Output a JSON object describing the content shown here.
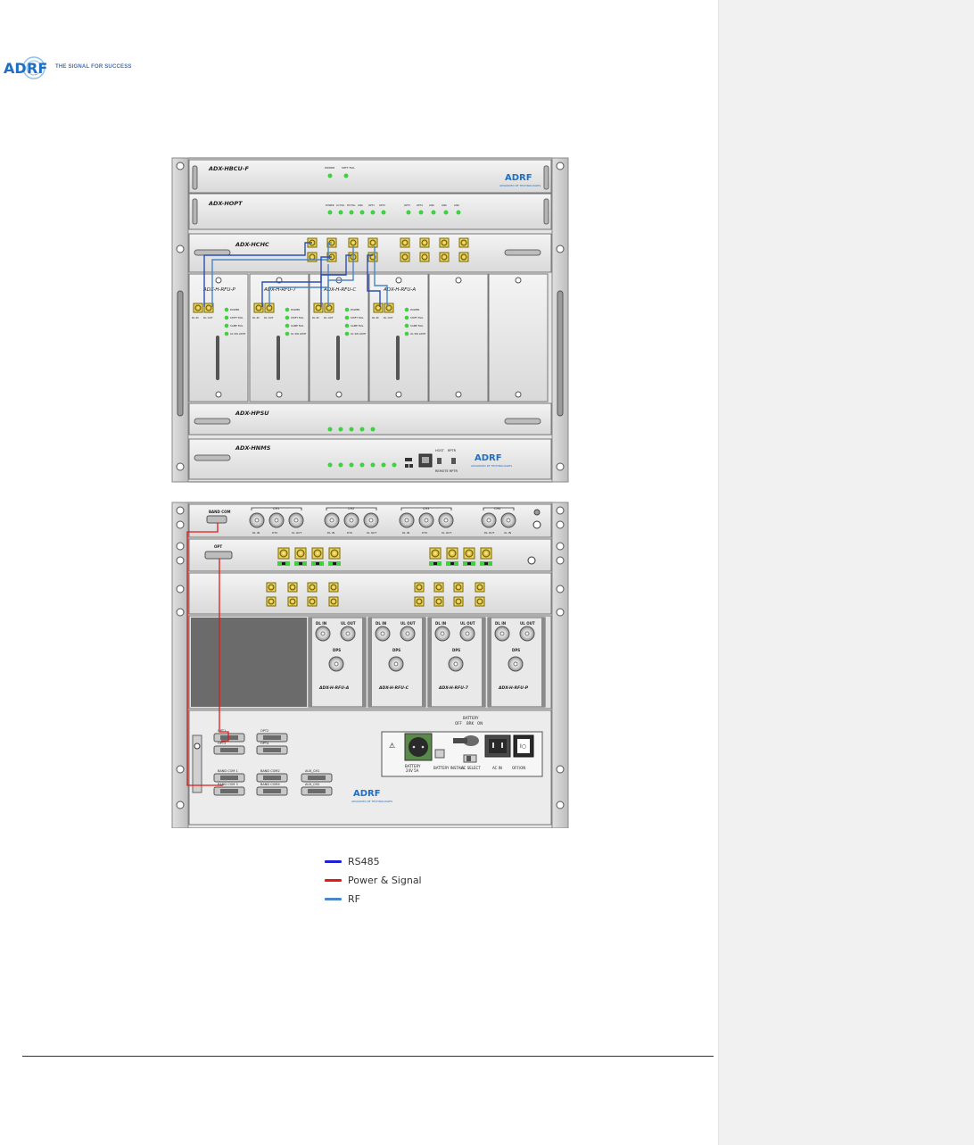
{
  "logo": {
    "wordmark": "ADRF",
    "tagline": "THE SIGNAL FOR SUCCESS",
    "colors": {
      "blue": "#1f6fc4",
      "light": "#8fc1ea"
    }
  },
  "front_panel": {
    "modules": {
      "bcu": "ADX-HBCU-F",
      "opt": "ADX-HOPT",
      "mchc": "ADX-HCHC",
      "psu": "ADX-HPSU",
      "nms": "ADX-HNMS"
    },
    "rfus": [
      "ADX-H-RFU-P",
      "ADX-H-RFU-7",
      "ADX-H-RFU-C",
      "ADX-H-RFU-A"
    ],
    "rfu_ports": {
      "dl_in": "DL IN",
      "dl_out": "DL OUT"
    },
    "rfu_leds": [
      "POWER",
      "SHIFT FAIL",
      "SAME FAIL",
      "UL SW LIMIT"
    ],
    "bcu_leds": [
      "POWER",
      "SHFT FAIL"
    ],
    "opt_leds": [
      "POWER",
      "LD FAIL",
      "PD FAIL",
      "LINK",
      "OPT1",
      "OPT2",
      "OPT3",
      "OPT4",
      "LINK",
      "LINK",
      "LINK"
    ],
    "nms_labels": {
      "host": "HOST",
      "repeater": "RPTR",
      "remote": "REMOTE RPTR"
    },
    "brand_small": "ADVANCED RF TECHNOLOGIES"
  },
  "rear_panel": {
    "band_com": "BAND COM",
    "opt": "OPT",
    "channel_groups": [
      "CH1",
      "CH2",
      "CH3",
      "CH4"
    ],
    "channel_ports": [
      "DL IN",
      "DTX",
      "UL OUT"
    ],
    "aux_ports": [
      "DL OUT",
      "UL IN"
    ],
    "rfus": [
      "ADX-H-RFU-A",
      "ADX-H-RFU-C",
      "ADX-H-RFU-7",
      "ADX-H-RFU-P"
    ],
    "rfu_ports": {
      "dl_in": "DL IN",
      "ul_out": "UL OUT",
      "dps": "DPS"
    },
    "connectors": [
      "OPT1",
      "OPT2",
      "OPT3",
      "OPT4",
      "BAND COM 1",
      "BAND COM2",
      "AUX_CH1",
      "BAND COM 3",
      "BAND COM4",
      "AUX_CH2"
    ],
    "battery": {
      "title": "BATTERY",
      "switch_states": [
        "OFF",
        "BRK",
        "ON"
      ],
      "voltage": "24V 5A",
      "install": "BATTERY INSTALL",
      "ac_select": "AC SELECT"
    },
    "ac": {
      "ac_in": "AC IN",
      "switch": "OFF/ON"
    }
  },
  "legend": [
    {
      "label": "RS485",
      "color": "#1f1fd6"
    },
    {
      "label": "Power & Signal",
      "color": "#e01b1b"
    },
    {
      "label": "RF",
      "color": "#4a86c8"
    }
  ]
}
